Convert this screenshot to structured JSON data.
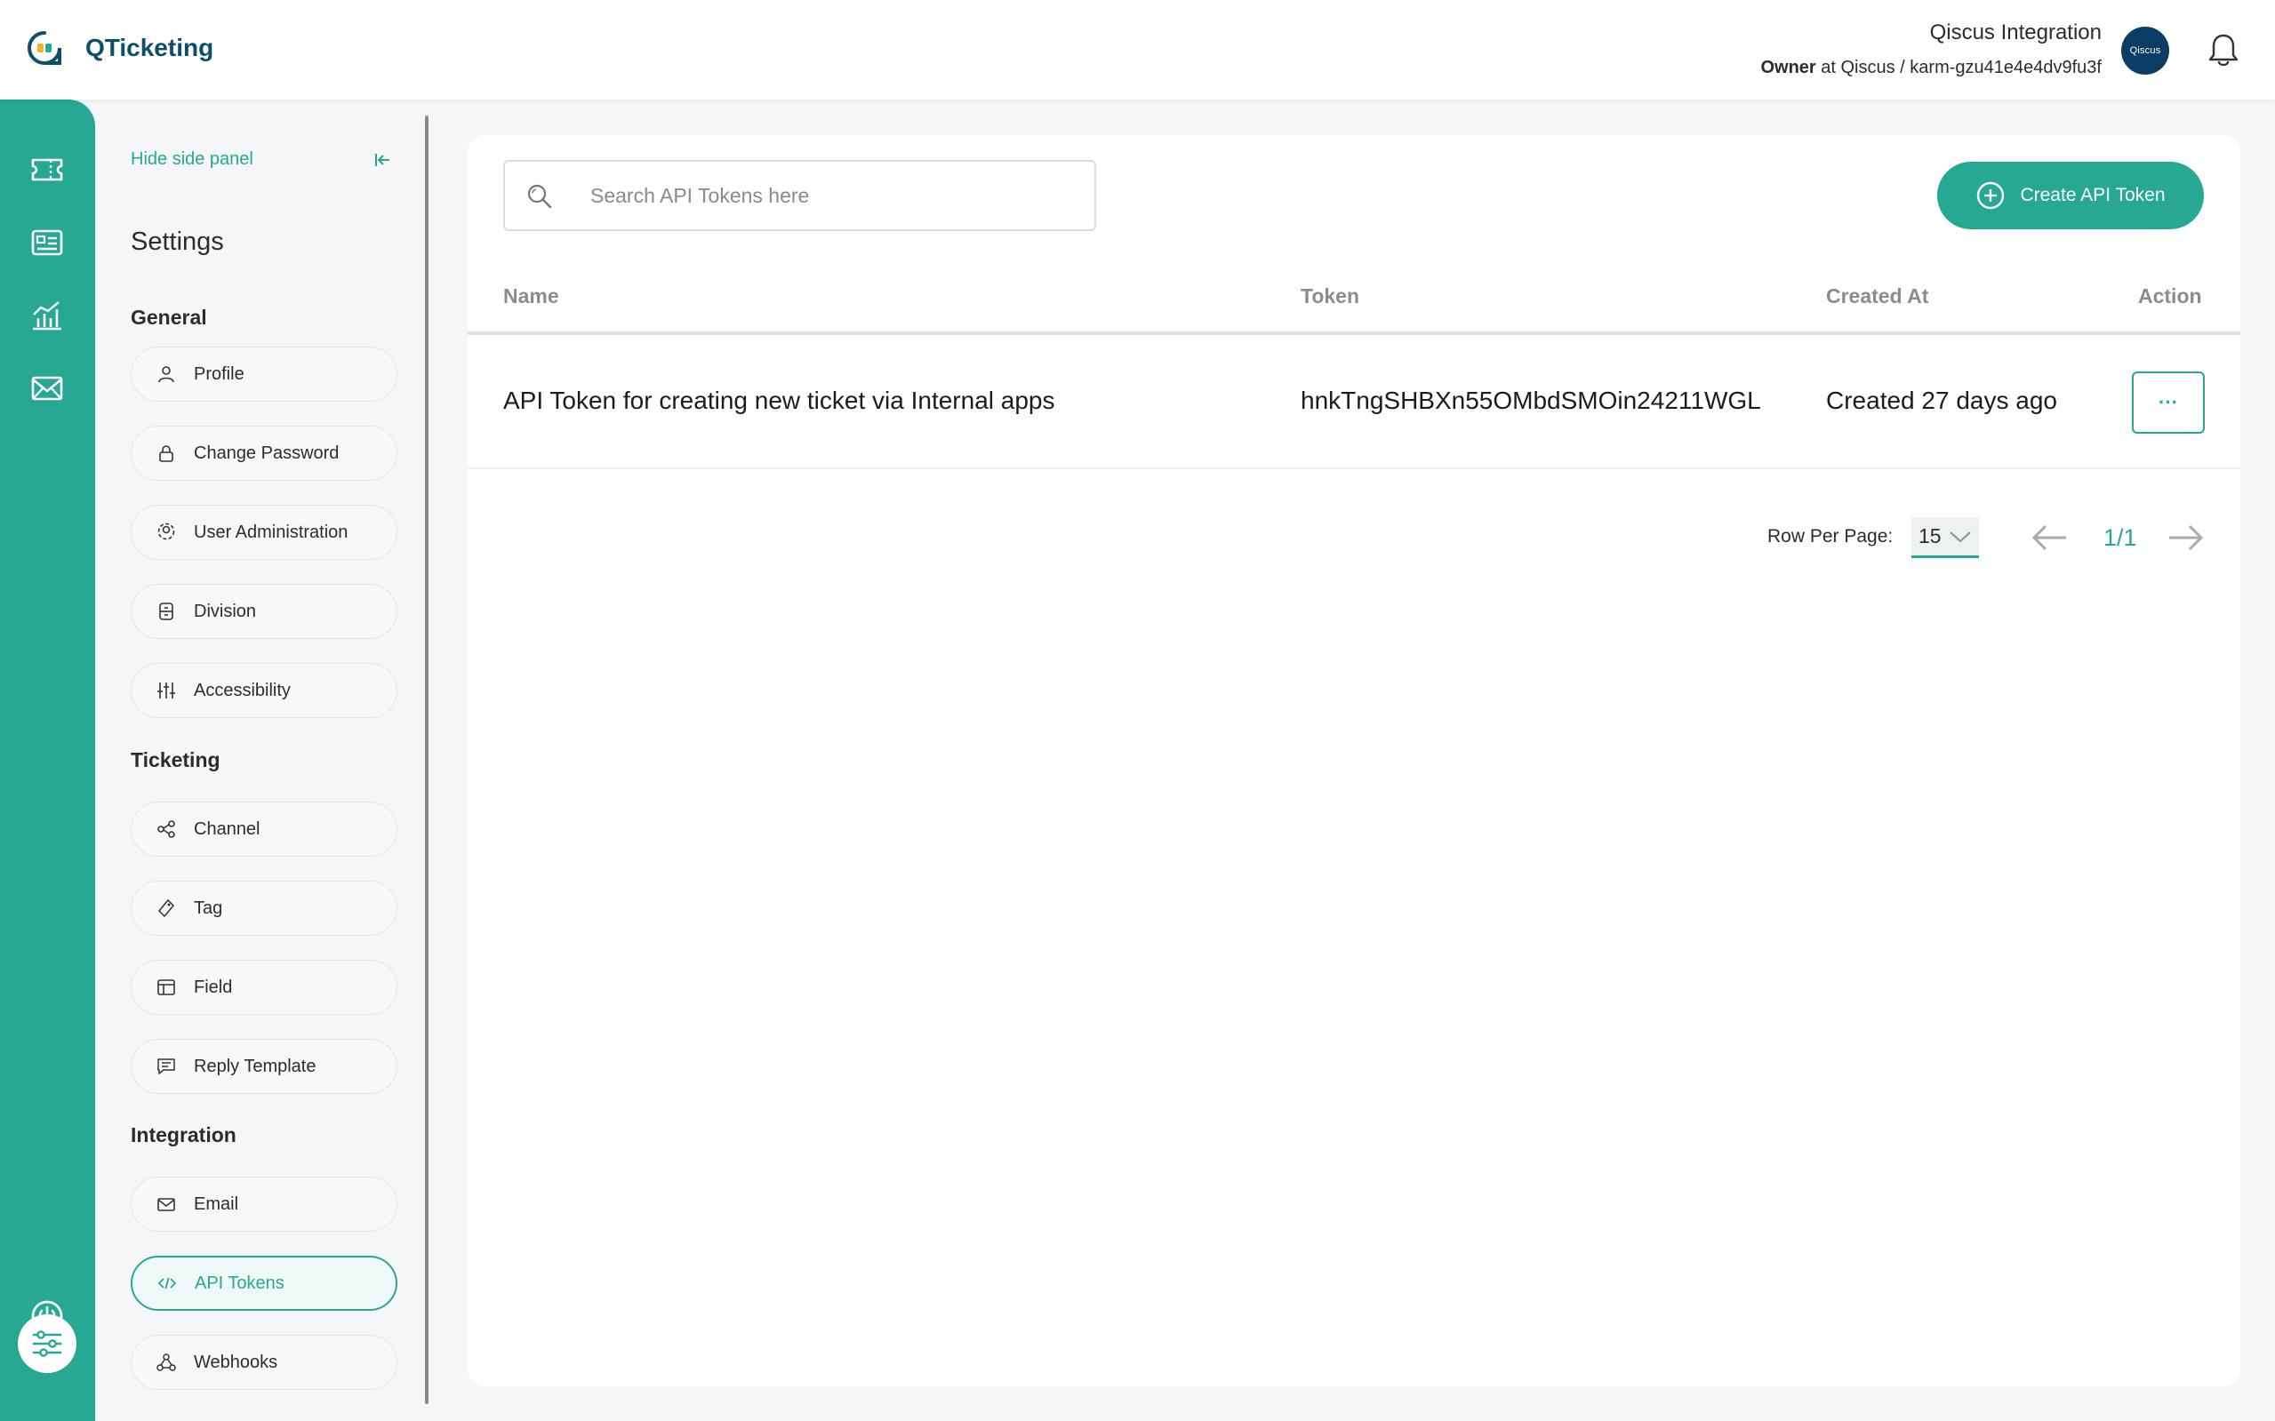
{
  "app": {
    "name": "QTicketing"
  },
  "user": {
    "name": "Qiscus Integration",
    "role": "Owner",
    "at": "at Qiscus / karm-gzu41e4e4dv9fu3f",
    "avatar_text": "Qiscus"
  },
  "side_panel": {
    "hide_label": "Hide side panel",
    "title": "Settings",
    "sections": {
      "general": "General",
      "ticketing": "Ticketing",
      "integration": "Integration"
    },
    "items": {
      "profile": "Profile",
      "change_password": "Change Password",
      "user_administration": "User Administration",
      "division": "Division",
      "accessibility": "Accessibility",
      "channel": "Channel",
      "tag": "Tag",
      "field": "Field",
      "reply_template": "Reply Template",
      "email": "Email",
      "api_tokens": "API Tokens",
      "webhooks": "Webhooks"
    },
    "active_item": "api_tokens"
  },
  "main": {
    "search": {
      "placeholder": "Search API Tokens here",
      "value": ""
    },
    "create_button": "Create API Token",
    "table": {
      "columns": {
        "name": "Name",
        "token": "Token",
        "created_at": "Created At",
        "action": "Action"
      },
      "rows": [
        {
          "name": "API Token for creating new ticket via Internal apps",
          "token": "hnkTngSHBXn55OMbdSMOin24211WGL",
          "created_at": "Created 27 days ago",
          "action": "···"
        }
      ]
    },
    "pagination": {
      "rows_per_page_label": "Row Per Page:",
      "rows_per_page": "15",
      "page": "1/1"
    }
  },
  "colors": {
    "accent": "#26a892",
    "brand_text": "#0d4f6b",
    "avatar_bg": "#0b3d64"
  },
  "icons": {
    "rail": [
      "ticket-icon",
      "contact-card-icon",
      "analytics-icon",
      "mail-icon",
      "settings-sliders-icon",
      "power-icon"
    ],
    "header": [
      "qticketing-logo-icon",
      "bell-icon"
    ]
  }
}
